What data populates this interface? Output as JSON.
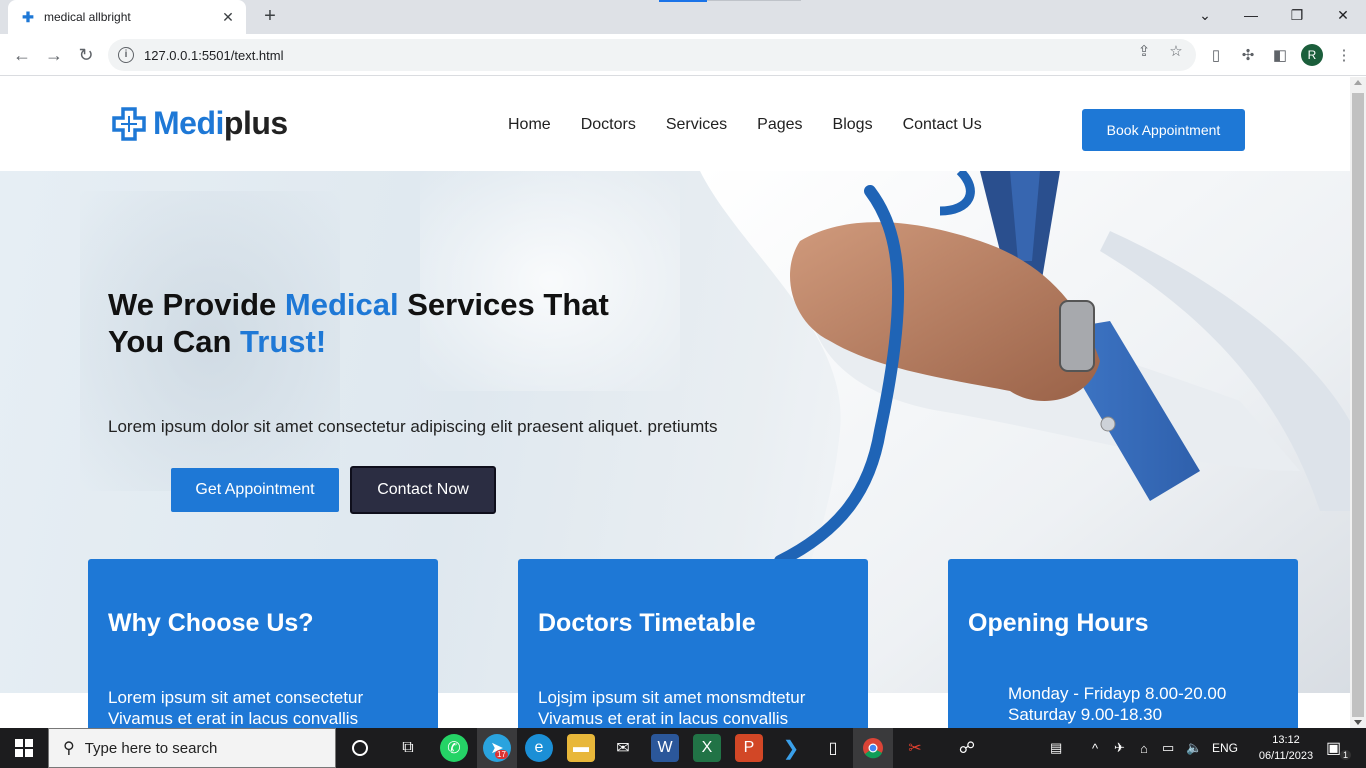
{
  "browser": {
    "tab_title": "medical allbright",
    "url": "127.0.0.1:5501/text.html",
    "profile_initial": "R"
  },
  "site": {
    "brand_part1": "Medi",
    "brand_part2": "plus",
    "nav": [
      "Home",
      "Doctors",
      "Services",
      "Pages",
      "Blogs",
      "Contact Us"
    ],
    "book_button": "Book Appointment",
    "accent_color": "#1e78d6"
  },
  "hero": {
    "title_parts": [
      "We Provide ",
      "Medical",
      " Services That",
      "You Can ",
      "Trust!"
    ],
    "lead": "Lorem ipsum dolor sit amet consectetur adipiscing elit praesent aliquet. pretiumts",
    "primary_button": "Get Appointment",
    "secondary_button": "Contact Now"
  },
  "cards": [
    {
      "title": "Why Choose Us?",
      "lines": [
        "Lorem ipsum sit amet consectetur",
        "Vivamus et erat in lacus convallis"
      ]
    },
    {
      "title": "Doctors Timetable",
      "lines": [
        "Lojsjm ipsum sit amet monsmdtetur",
        "Vivamus et erat in lacus convallis"
      ]
    },
    {
      "title": "Opening Hours",
      "lines": [
        "Monday - Fridayp 8.00-20.00",
        "Saturday 9.00-18.30"
      ]
    }
  ],
  "taskbar": {
    "search_placeholder": "Type here to search",
    "telegram_badge": "17",
    "language": "ENG",
    "time": "13:12",
    "date": "06/11/2023",
    "notifications": "1"
  }
}
